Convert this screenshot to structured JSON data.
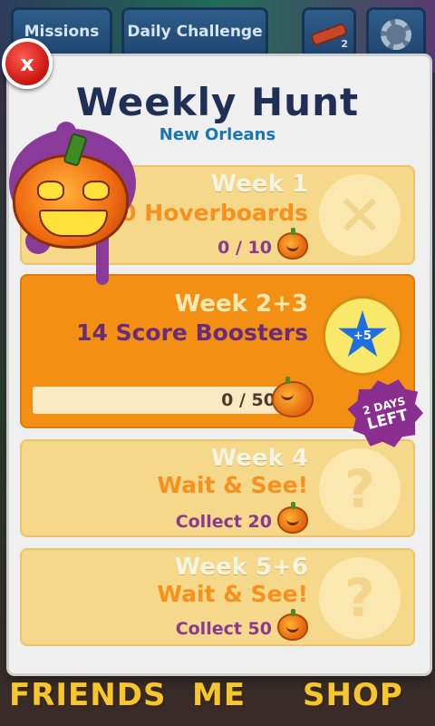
{
  "top_bar": {
    "missions_label": "Missions",
    "daily_challenge_label": "Daily Challenge",
    "hoverboard_count": "2"
  },
  "dialog": {
    "close_label": "x",
    "title": "Weekly Hunt",
    "subtitle": "New Orleans",
    "weeks": [
      {
        "week": "Week 1",
        "reward": "10 Hoverboards",
        "progress_text": "0 / 10",
        "status_icon": "x-icon"
      },
      {
        "week": "Week 2+3",
        "reward": "14 Score Boosters",
        "progress_text": "0 / 50",
        "progress": 0,
        "booster_label": "+5",
        "status_icon": "score-booster-icon"
      },
      {
        "week": "Week 4",
        "reward": "Wait & See!",
        "progress_text": "Collect 20",
        "status_icon": "question-icon"
      },
      {
        "week": "Week 5+6",
        "reward": "Wait & See!",
        "progress_text": "Collect 50",
        "status_icon": "question-icon"
      }
    ],
    "days_left_number": "2 DAYS",
    "days_left_word": "LEFT"
  },
  "bottom_nav": {
    "friends_label": "FRIENDS",
    "me_label": "ME",
    "shop_label": "SHOP"
  },
  "colors": {
    "panel": "#efefef",
    "active_card": "#f39014",
    "pale_card": "#f5d88a",
    "title": "#1f2f56",
    "subtitle": "#1a75b5"
  }
}
